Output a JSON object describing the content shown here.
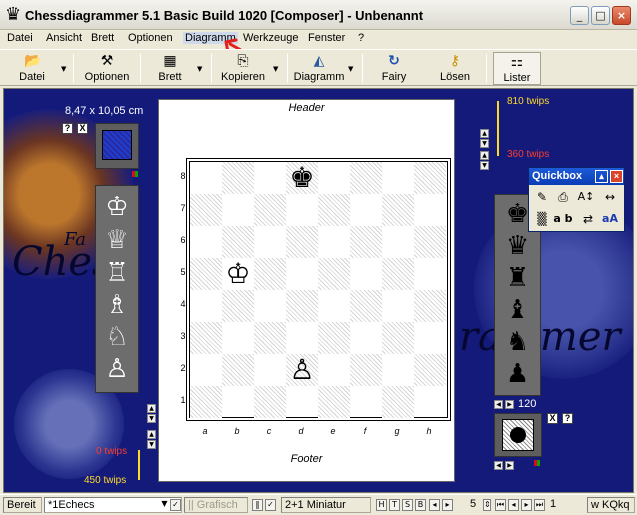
{
  "window": {
    "title": "Chessdiagrammer 5.1 Basic Build 1020  [Composer] - Unbenannt",
    "app_icon": "♛",
    "minimize": "_",
    "maximize": "□",
    "close": "×"
  },
  "menu": {
    "items": [
      "Datei",
      "Ansicht",
      "Brett",
      "Optionen",
      "Diagramm",
      "Werkzeuge",
      "Fenster",
      "?"
    ],
    "highlighted": "Diagramm"
  },
  "toolbar": {
    "buttons": [
      {
        "label": "Datei",
        "icon": "open-folder-icon",
        "glyph": "📂"
      },
      {
        "label": "Optionen",
        "icon": "tools-icon",
        "glyph": "⚒"
      },
      {
        "label": "Brett",
        "icon": "board-icon",
        "glyph": "▦"
      },
      {
        "label": "Kopieren",
        "icon": "copy-icon",
        "glyph": "⎘"
      },
      {
        "label": "Diagramm",
        "icon": "diagram-icon",
        "glyph": "◭"
      },
      {
        "label": "Fairy",
        "icon": "fairy-icon",
        "glyph": "↻"
      },
      {
        "label": "Lösen",
        "icon": "key-icon",
        "glyph": "⚷"
      },
      {
        "label": "Lister",
        "icon": "lister-icon",
        "glyph": "⚏"
      }
    ],
    "dropdown_glyph": "▼"
  },
  "workarea": {
    "size_label": "8,47 x 10,05 cm",
    "top_right_twips": "810 twips",
    "mid_right_twips": "360 twips",
    "bottom_left_red_twips": "0 twips",
    "bottom_left_yellow_twips": "450 twips",
    "right_counter": "120",
    "help_btn": "?",
    "close_btn": "X"
  },
  "page": {
    "header": "Header",
    "footer": "Footer"
  },
  "board": {
    "ranks": [
      "8",
      "7",
      "6",
      "5",
      "4",
      "3",
      "2",
      "1"
    ],
    "files": [
      "a",
      "b",
      "c",
      "d",
      "e",
      "f",
      "g",
      "h"
    ],
    "pieces": [
      {
        "square": "d8",
        "glyph": "♚",
        "color": "black"
      },
      {
        "square": "b5",
        "glyph": "♔",
        "color": "white"
      },
      {
        "square": "d2",
        "glyph": "♙",
        "color": "white"
      }
    ]
  },
  "white_palette": [
    "♔",
    "♕",
    "♖",
    "♗",
    "♘",
    "♙"
  ],
  "black_palette": [
    "♚",
    "♛",
    "♜",
    "♝",
    "♞",
    "♟"
  ],
  "quickbox": {
    "title": "Quickbox",
    "icons": [
      "brush-icon",
      "stamp-icon",
      "font-size-icon",
      "width-icon",
      "pattern-icon",
      "ab-icon",
      "swap-icon",
      "font-icon"
    ],
    "glyphs": [
      "✎",
      "⎙",
      "A↕",
      "↔",
      "▒",
      "a b",
      "⇄",
      "aA"
    ]
  },
  "status": {
    "state": "Bereit",
    "font_select": "*1Echecs",
    "grafisch": "|| Grafisch",
    "classification": "2+1 Miniatur",
    "stipulation_buttons": [
      "H",
      "T",
      "S",
      "B"
    ],
    "page_number": "5",
    "counter": "1",
    "castling": "w KQkq"
  },
  "colors": {
    "workarea_bg": "#141a7a",
    "twips_yellow": "#ffd92a",
    "twips_red": "#ff3c2c",
    "annotation_arrow": "#e3201b"
  }
}
